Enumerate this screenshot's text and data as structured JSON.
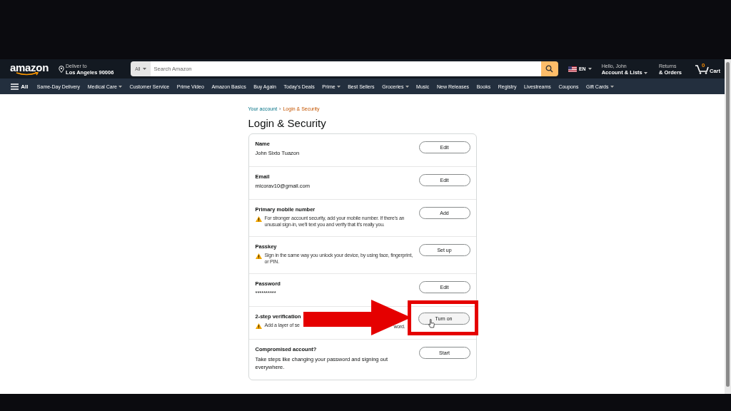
{
  "header": {
    "logo": "amazon",
    "deliver_label": "Deliver to",
    "deliver_location": "Los Angeles 90006",
    "search_category": "All",
    "search_placeholder": "Search Amazon",
    "language": "EN",
    "greeting": "Hello, John",
    "account": "Account & Lists",
    "returns": "Returns",
    "orders": "& Orders",
    "cart_count": "0",
    "cart": "Cart"
  },
  "nav": {
    "all": "All",
    "items": [
      {
        "label": "Same-Day Delivery",
        "dropdown": false
      },
      {
        "label": "Medical Care",
        "dropdown": true
      },
      {
        "label": "Customer Service",
        "dropdown": false
      },
      {
        "label": "Prime Video",
        "dropdown": false
      },
      {
        "label": "Amazon Basics",
        "dropdown": false
      },
      {
        "label": "Buy Again",
        "dropdown": false
      },
      {
        "label": "Today's Deals",
        "dropdown": false
      },
      {
        "label": "Prime",
        "dropdown": true
      },
      {
        "label": "Best Sellers",
        "dropdown": false
      },
      {
        "label": "Groceries",
        "dropdown": true
      },
      {
        "label": "Music",
        "dropdown": false
      },
      {
        "label": "New Releases",
        "dropdown": false
      },
      {
        "label": "Books",
        "dropdown": false
      },
      {
        "label": "Registry",
        "dropdown": false
      },
      {
        "label": "Livestreams",
        "dropdown": false
      },
      {
        "label": "Coupons",
        "dropdown": false
      },
      {
        "label": "Gift Cards",
        "dropdown": true
      }
    ]
  },
  "breadcrumb_separator": "›",
  "breadcrumb": [
    {
      "label": "Your account",
      "current": false
    },
    {
      "label": "Login & Security",
      "current": true
    }
  ],
  "title": "Login & Security",
  "rows": [
    {
      "label": "Name",
      "kind": "value",
      "text": "John Sixto Tuazon",
      "button": "Edit",
      "highlighted": false
    },
    {
      "label": "Email",
      "kind": "value",
      "text": "micorav10@gmail.com",
      "button": "Edit",
      "highlighted": false
    },
    {
      "label": "Primary mobile number",
      "kind": "warning",
      "text": "For stronger account security, add your mobile number. If there's an unusual sign-in, we'll text you and verify that it's really you.",
      "button": "Add",
      "highlighted": false
    },
    {
      "label": "Passkey",
      "kind": "warning",
      "text": "Sign in the same way you unlock your device, by using face, fingerprint, or PIN.",
      "button": "Set up",
      "highlighted": false
    },
    {
      "label": "Password",
      "kind": "value",
      "text": "**********",
      "button": "Edit",
      "highlighted": false
    },
    {
      "label": "2-step verification",
      "kind": "warning",
      "text": "Add a layer of se",
      "text_end": "word.",
      "button": "Turn on",
      "highlighted": true
    },
    {
      "label": "Compromised account?",
      "kind": "plain",
      "text": "Take steps like changing your password and signing out everywhere.",
      "button": "Start",
      "highlighted": false
    }
  ]
}
